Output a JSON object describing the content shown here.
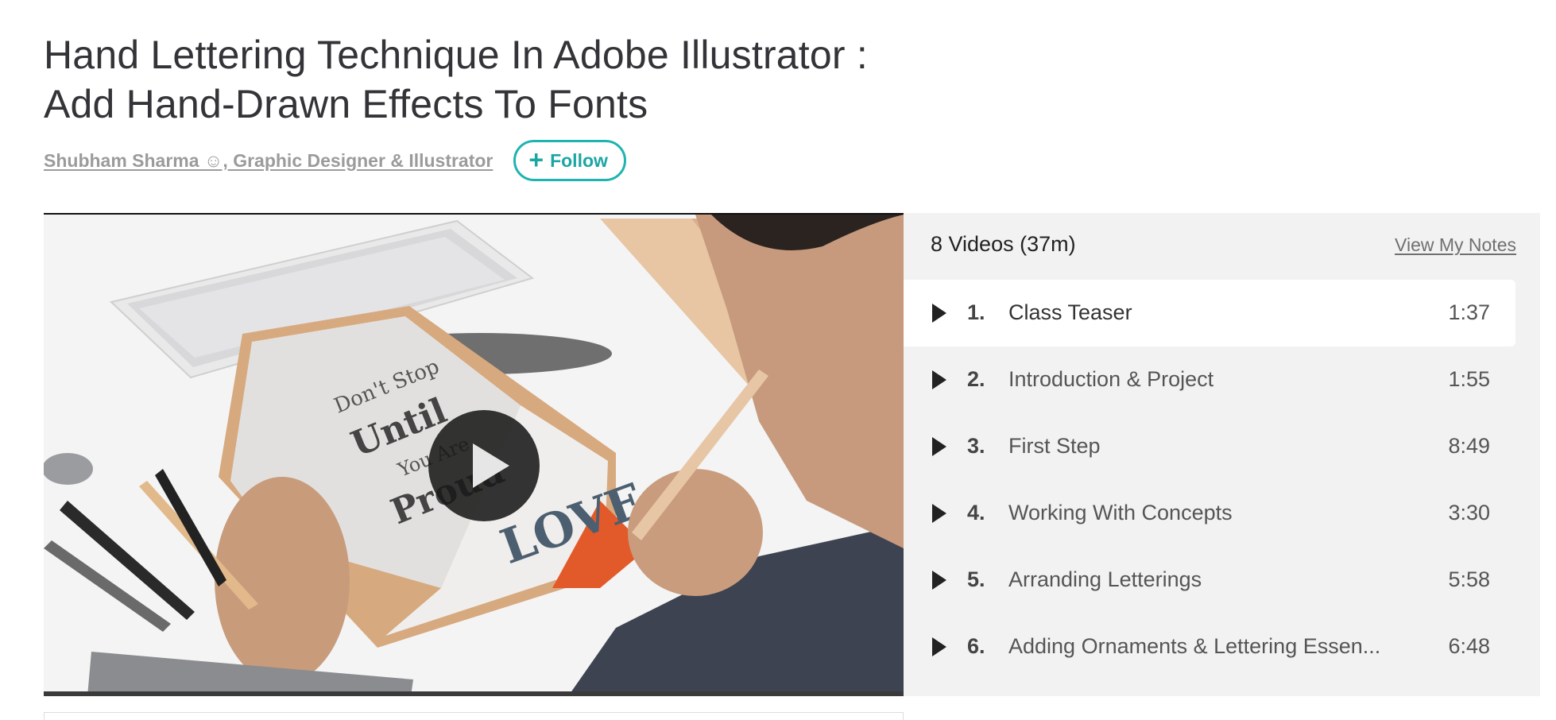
{
  "course": {
    "title_line1": "Hand Lettering Technique In Adobe Illustrator :",
    "title_line2": "Add Hand-Drawn Effects To Fonts",
    "author": "Shubham Sharma ☺, Graphic Designer & Illustrator",
    "follow_label": "Follow"
  },
  "video": {
    "thumbnail_desc": "hands-lettering-notebook",
    "notebook_text": [
      "Don't Stop",
      "Until",
      "You Are",
      "Proud"
    ],
    "love_text": "LOVE"
  },
  "playlist": {
    "count_label": "8 Videos (37m)",
    "notes_link": "View My Notes",
    "items": [
      {
        "num": "1.",
        "title": "Class Teaser",
        "duration": "1:37",
        "active": true
      },
      {
        "num": "2.",
        "title": "Introduction & Project",
        "duration": "1:55",
        "active": false
      },
      {
        "num": "3.",
        "title": "First Step",
        "duration": "8:49",
        "active": false
      },
      {
        "num": "4.",
        "title": "Working With Concepts",
        "duration": "3:30",
        "active": false
      },
      {
        "num": "5.",
        "title": "Arranding Letterings",
        "duration": "5:58",
        "active": false
      },
      {
        "num": "6.",
        "title": "Adding Ornaments & Lettering Essen...",
        "duration": "6:48",
        "active": false
      }
    ]
  },
  "colors": {
    "accent": "#1fb3b1",
    "playlist_bg": "#f2f2f3"
  }
}
